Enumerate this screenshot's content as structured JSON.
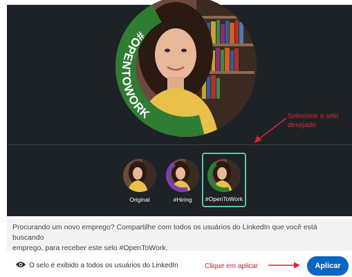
{
  "preview": {
    "frame_text": "#OPENTOWORK",
    "frame_color": "#2e7d32"
  },
  "annotations": {
    "select_line1": "Selecione o selo",
    "select_line2": "desejado",
    "apply_hint": "Clique em aplicar",
    "color": "#e0242a"
  },
  "frames": [
    {
      "label": "Original"
    },
    {
      "label": "#Hiring",
      "ring_color": "#7b3fb0"
    },
    {
      "label": "#OpenToWork",
      "ring_color": "#2e7d32",
      "selected": true
    }
  ],
  "description": {
    "line1": "Procurando um novo emprego? Compartilhe com todos os usuários do LinkedIn que você está buscando",
    "line2": "emprego, para receber este selo #OpenToWork."
  },
  "visibility": {
    "icon": "eye-icon",
    "text": "O selo é exibido a todos os usuários do LinkedIn"
  },
  "apply_button": {
    "label": "Aplicar",
    "color": "#0a66c2"
  }
}
